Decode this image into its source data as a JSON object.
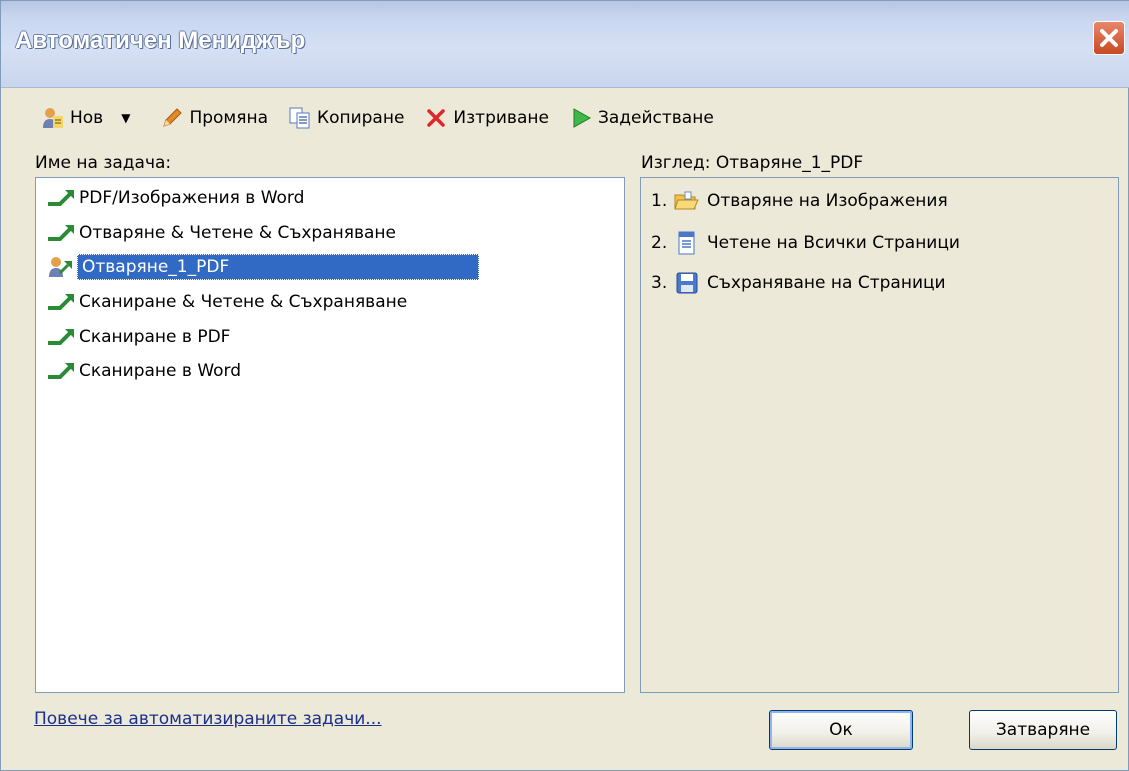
{
  "window": {
    "title": "Автоматичен Мениджър"
  },
  "toolbar": {
    "new_label": "Нов",
    "edit_label": "Промяна",
    "copy_label": "Копиране",
    "delete_label": "Изтриване",
    "run_label": "Задействане"
  },
  "tasks": {
    "header": "Име на задача:",
    "items": [
      {
        "label": "PDF/Изображения в Word",
        "icon": "task-arrow-icon"
      },
      {
        "label": "Отваряне & Четене & Съхраняване",
        "icon": "task-arrow-icon"
      },
      {
        "label": "Отваряне_1_PDF",
        "icon": "user-task-icon",
        "selected": true
      },
      {
        "label": "Сканиране & Четене & Съхраняване",
        "icon": "task-arrow-icon"
      },
      {
        "label": "Сканиране в PDF",
        "icon": "task-arrow-icon"
      },
      {
        "label": "Сканиране в Word",
        "icon": "task-arrow-icon"
      }
    ]
  },
  "preview": {
    "header": "Изглед: Отваряне_1_PDF",
    "steps": [
      {
        "num": "1.",
        "label": "Отваряне на Изображения",
        "icon": "open-folder-icon"
      },
      {
        "num": "2.",
        "label": "Четене на Всички Страници",
        "icon": "document-icon"
      },
      {
        "num": "3.",
        "label": "Съхраняване на Страници",
        "icon": "floppy-disk-icon"
      }
    ]
  },
  "footer": {
    "link": "Повече за автоматизираните задачи...",
    "ok_label": "Ок",
    "close_label": "Затваряне"
  },
  "colors": {
    "selection": "#316ac5",
    "link": "#1b2f8a",
    "close": "#c94a22"
  }
}
